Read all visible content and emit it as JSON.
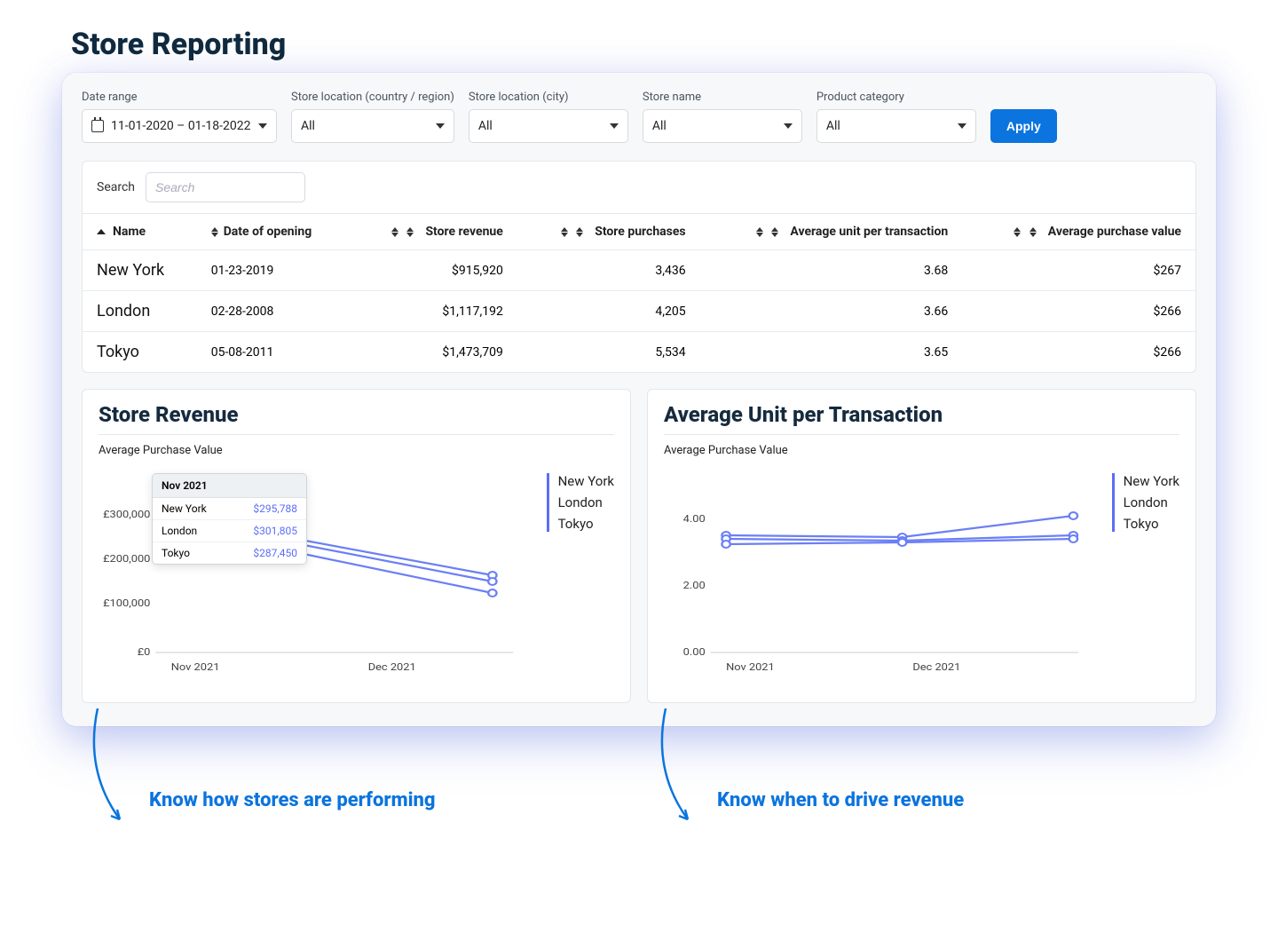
{
  "page_title": "Store Reporting",
  "filters": {
    "date_range": {
      "label": "Date range",
      "value": "11-01-2020 – 01-18-2022"
    },
    "country": {
      "label": "Store location (country / region)",
      "value": "All"
    },
    "city": {
      "label": "Store location (city)",
      "value": "All"
    },
    "store_name": {
      "label": "Store name",
      "value": "All"
    },
    "category": {
      "label": "Product category",
      "value": "All"
    },
    "apply_label": "Apply"
  },
  "search": {
    "label": "Search",
    "placeholder": "Search"
  },
  "table": {
    "columns": {
      "name": "Name",
      "date_open": "Date of opening",
      "revenue": "Store revenue",
      "purchases": "Store purchases",
      "avg_unit": "Average unit per transaction",
      "avg_value": "Average purchase value"
    },
    "rows": [
      {
        "name": "New York",
        "date_open": "01-23-2019",
        "revenue": "$915,920",
        "purchases": "3,436",
        "avg_unit": "3.68",
        "avg_value": "$267"
      },
      {
        "name": "London",
        "date_open": "02-28-2008",
        "revenue": "$1,117,192",
        "purchases": "4,205",
        "avg_unit": "3.66",
        "avg_value": "$266"
      },
      {
        "name": "Tokyo",
        "date_open": "05-08-2011",
        "revenue": "$1,473,709",
        "purchases": "5,534",
        "avg_unit": "3.65",
        "avg_value": "$266"
      }
    ]
  },
  "charts": {
    "revenue": {
      "title": "Store Revenue",
      "subtitle": "Average Purchase Value",
      "legend": [
        "New York",
        "London",
        "Tokyo"
      ],
      "tooltip": {
        "header": "Nov 2021",
        "rows": [
          {
            "label": "New York",
            "value": "$295,788"
          },
          {
            "label": "London",
            "value": "$301,805"
          },
          {
            "label": "Tokyo",
            "value": "$287,450"
          }
        ]
      },
      "y_ticks": [
        "£300,000",
        "£200,000",
        "£100,000",
        "£0"
      ],
      "x_ticks": [
        "Nov 2021",
        "Dec 2021"
      ]
    },
    "avg_unit": {
      "title": "Average Unit per Transaction",
      "subtitle": "Average Purchase Value",
      "legend": [
        "New York",
        "London",
        "Tokyo"
      ],
      "y_ticks": [
        "4.00",
        "2.00",
        "0.00"
      ],
      "x_ticks": [
        "Nov 2021",
        "Dec 2021"
      ]
    }
  },
  "annotations": {
    "left": "Know how stores are performing",
    "right": "Know when to drive revenue"
  },
  "chart_data": [
    {
      "type": "line",
      "title": "Store Revenue",
      "subtitle": "Average Purchase Value",
      "xlabel": "",
      "ylabel": "",
      "categories": [
        "Nov 2021",
        "Dec 2021"
      ],
      "series": [
        {
          "name": "New York",
          "values": [
            295788,
            175000
          ]
        },
        {
          "name": "London",
          "values": [
            301805,
            165000
          ]
        },
        {
          "name": "Tokyo",
          "values": [
            287450,
            150000
          ]
        }
      ],
      "ylim": [
        0,
        300000
      ],
      "y_ticks": [
        0,
        100000,
        200000,
        300000
      ],
      "currency": "£"
    },
    {
      "type": "line",
      "title": "Average Unit per Transaction",
      "subtitle": "Average Purchase Value",
      "xlabel": "",
      "ylabel": "",
      "categories": [
        "Nov 2021",
        "Dec 2021"
      ],
      "series": [
        {
          "name": "New York",
          "values": [
            3.6,
            4.05
          ]
        },
        {
          "name": "London",
          "values": [
            3.55,
            3.6
          ]
        },
        {
          "name": "Tokyo",
          "values": [
            3.45,
            3.55
          ]
        }
      ],
      "ylim": [
        0,
        4
      ],
      "y_ticks": [
        0,
        2,
        4
      ]
    }
  ]
}
